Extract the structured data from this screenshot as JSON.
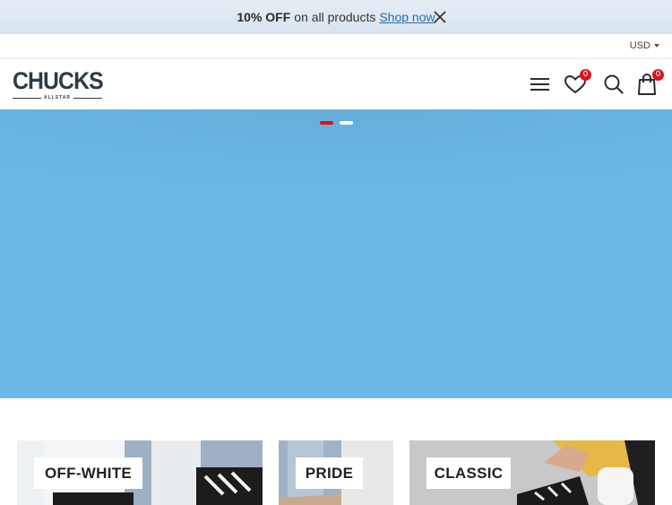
{
  "promo": {
    "off_text": "10% OFF",
    "rest_text": "on all products",
    "link_text": "Shop now",
    "close_icon": "close-icon"
  },
  "currency": {
    "selected": "USD"
  },
  "header": {
    "logo_text": "CHUCKS",
    "logo_subtext": "ALLSTAR",
    "menu_icon": "hamburger-menu-icon",
    "wishlist_icon": "heart-icon",
    "wishlist_count": "0",
    "search_icon": "search-icon",
    "cart_icon": "shopping-bag-icon",
    "cart_count": "0"
  },
  "hero": {
    "slide_count": 2,
    "active_slide": 1,
    "background_color": "#6ab7e6"
  },
  "colors": {
    "accent": "#d8141c",
    "text_dark": "#2f3a47",
    "link": "#2a6ea8",
    "hero_blue": "#6ab7e6"
  },
  "categories": [
    {
      "label": "OFF-WHITE"
    },
    {
      "label": "PRIDE"
    },
    {
      "label": "CLASSIC"
    }
  ]
}
